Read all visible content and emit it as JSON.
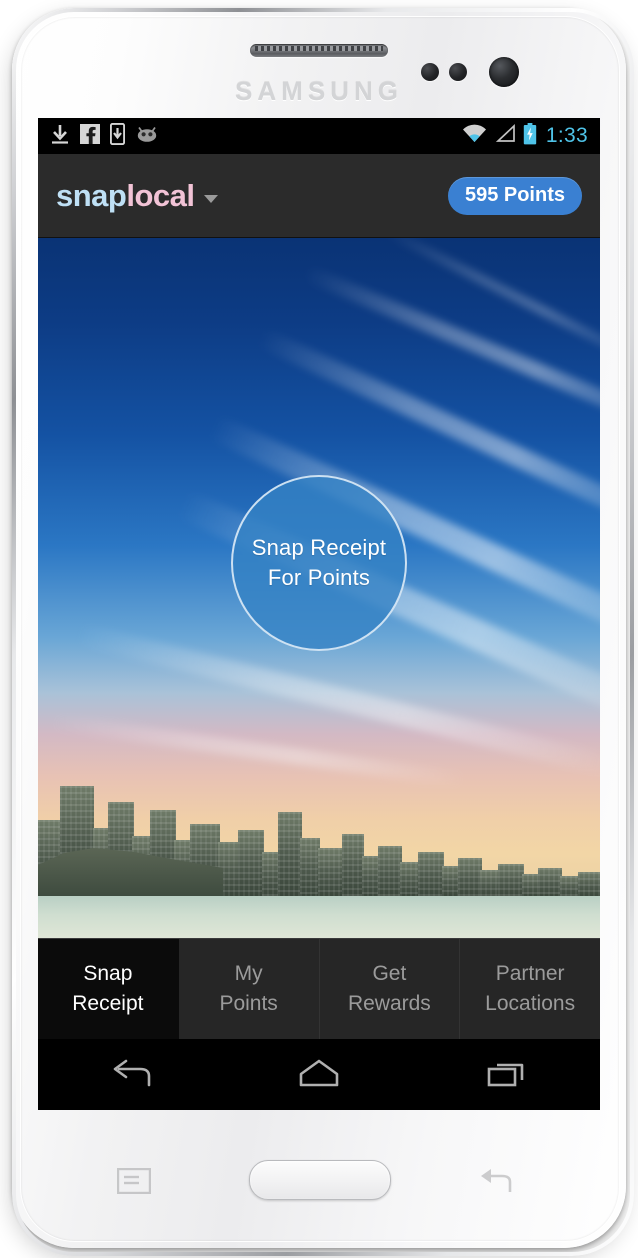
{
  "device": {
    "brand": "SAMSUNG",
    "earpiece_icon": "earpiece-speaker-icon",
    "proximity_sensor_icon": "proximity-sensor-icon",
    "light_sensor_icon": "light-sensor-icon",
    "front_camera_icon": "front-camera-icon",
    "home_button_label": "",
    "menu_key_icon": "menu-key-icon",
    "back_key_icon": "back-key-icon"
  },
  "status_bar": {
    "left_icons": [
      {
        "name": "download-icon",
        "label": "download"
      },
      {
        "name": "facebook-icon",
        "label": "facebook"
      },
      {
        "name": "app-install-icon",
        "label": "app install"
      },
      {
        "name": "android-jellybean-icon",
        "label": "android system"
      }
    ],
    "right_icons": [
      {
        "name": "wifi-icon",
        "label": "wifi"
      },
      {
        "name": "cellular-signal-icon",
        "label": "cellular signal"
      },
      {
        "name": "battery-charging-icon",
        "label": "battery charging"
      }
    ],
    "clock": "1:33",
    "accent_color": "#4fc3e8",
    "background_color": "#000000"
  },
  "action_bar": {
    "logo_part_1": "snap",
    "logo_part_2": "local",
    "logo_color_1": "#bfe0f5",
    "logo_color_2": "#f2c3d6",
    "dropdown_icon": "chevron-down-icon",
    "points_badge": "595 Points",
    "points_badge_color": "#3a80d2",
    "background_color": "#2b2b2b"
  },
  "main": {
    "background_description": "city skyline at sunset under blue sky with cirrus clouds",
    "snap_button": {
      "line_1": "Snap Receipt",
      "line_2": "For Points",
      "fill_color": "#3482c4",
      "border_color": "#e8f2fa"
    }
  },
  "tab_bar": {
    "active_index": 0,
    "tabs": [
      {
        "line_1": "Snap",
        "line_2": "Receipt",
        "name": "tab-snap-receipt"
      },
      {
        "line_1": "My",
        "line_2": "Points",
        "name": "tab-my-points"
      },
      {
        "line_1": "Get",
        "line_2": "Rewards",
        "name": "tab-get-rewards"
      },
      {
        "line_1": "Partner",
        "line_2": "Locations",
        "name": "tab-partner-locations"
      }
    ],
    "active_background": "#0b0b0b",
    "inactive_background": "#262626"
  },
  "nav_bar": {
    "buttons": [
      {
        "name": "nav-back-button",
        "label": "Back"
      },
      {
        "name": "nav-home-button",
        "label": "Home"
      },
      {
        "name": "nav-recents-button",
        "label": "Recent apps"
      }
    ],
    "icon_color": "#b0b0b0",
    "background_color": "#000000"
  }
}
